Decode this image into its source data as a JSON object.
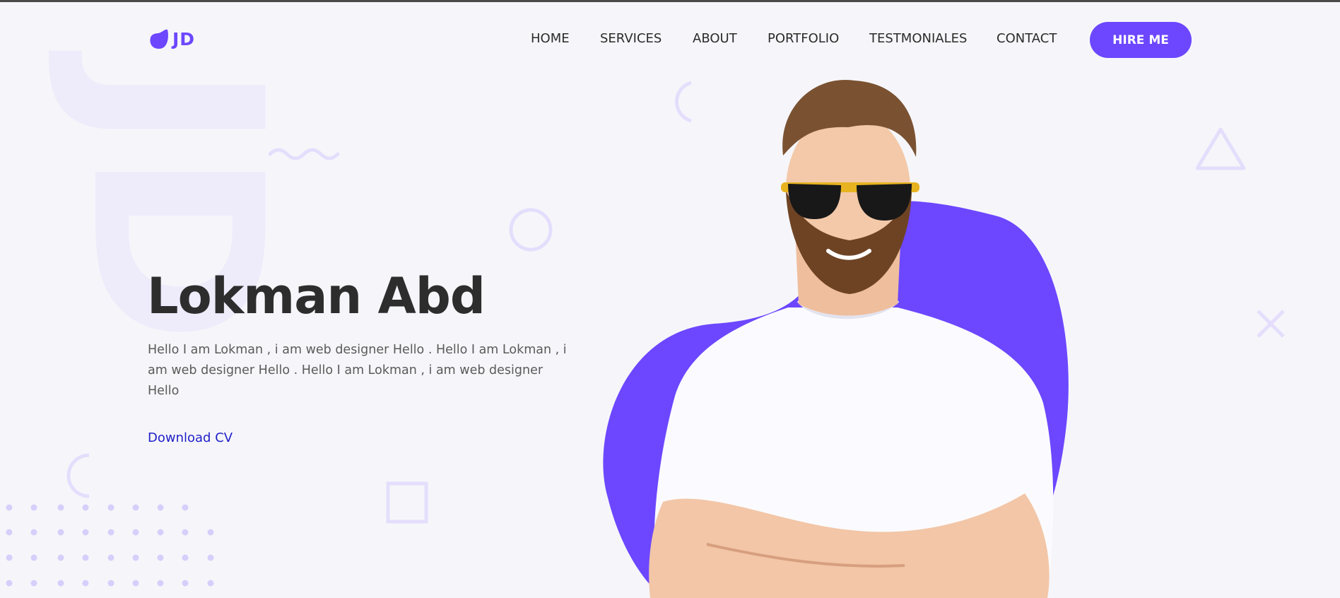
{
  "brand": {
    "logo_text": "JD",
    "accent": "#6c47ff",
    "watermark": "JD"
  },
  "nav": {
    "items": [
      {
        "label": "HOME"
      },
      {
        "label": "SERVICES"
      },
      {
        "label": "ABOUT"
      },
      {
        "label": "PORTFOLIO"
      },
      {
        "label": "TESTMONIALES"
      },
      {
        "label": "CONTACT"
      }
    ],
    "cta_label": "HIRE ME"
  },
  "hero": {
    "name": "Lokman Abd",
    "description": "Hello I am Lokman , i am web designer Hello . Hello I am Lokman , i am web designer Hello . Hello I am Lokman , i am web designer Hello",
    "download_label": "Download CV"
  },
  "icons": {
    "logo": "leaf-icon",
    "decor": [
      "half-circle-icon",
      "wave-icon",
      "circle-outline-icon",
      "triangle-outline-icon",
      "close-icon",
      "square-outline-icon",
      "dot-grid"
    ]
  },
  "colors": {
    "background": "#f6f6fa",
    "blob": "#6c47ff",
    "decor": "#e4defc",
    "link": "#1f1fc9"
  }
}
